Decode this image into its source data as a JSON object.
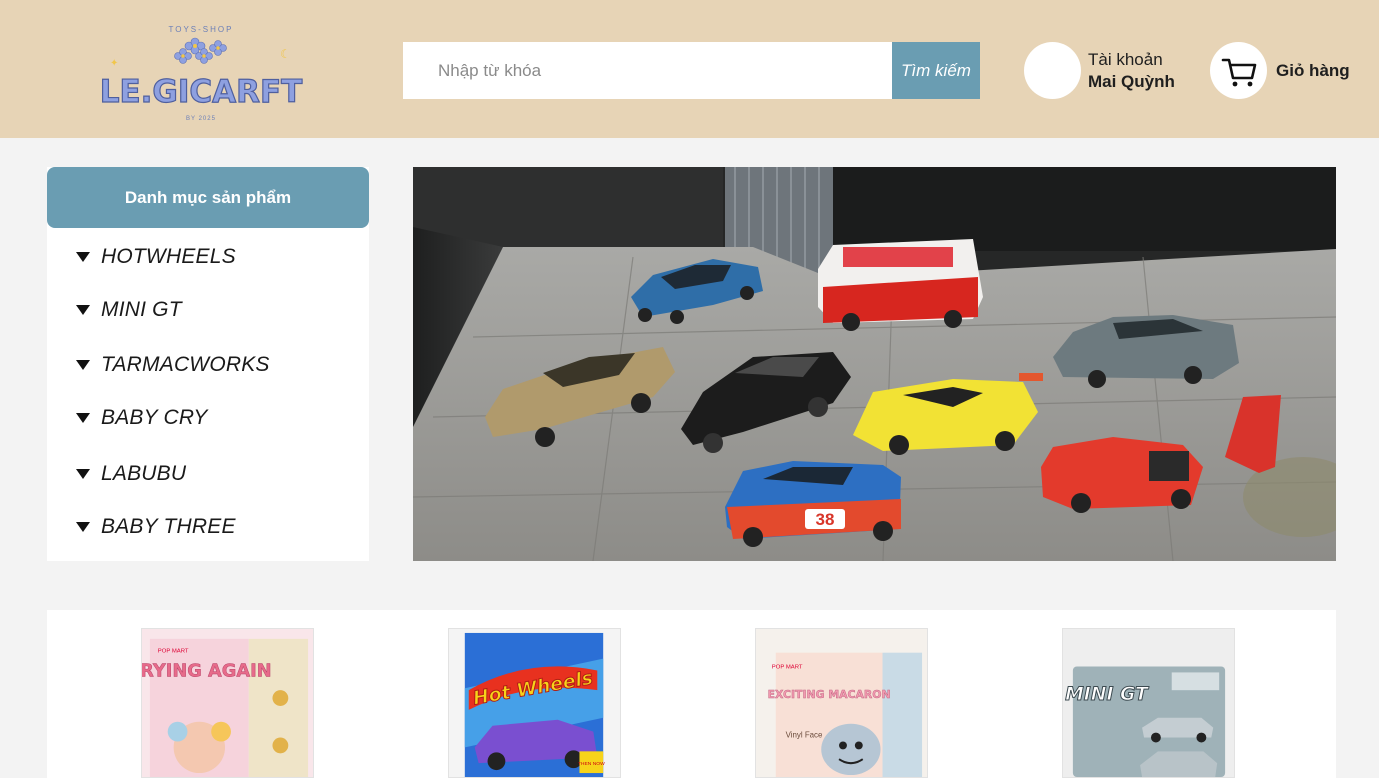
{
  "header": {
    "logo": {
      "top_text": "TOYS-SHOP",
      "brand": "LE.GICARFT",
      "tagline": "BY 2025"
    },
    "search": {
      "placeholder": "Nhập từ khóa",
      "button_label": "Tìm kiếm"
    },
    "account": {
      "label": "Tài khoản",
      "name": "Mai Quỳnh"
    },
    "cart": {
      "label": "Giỏ hàng",
      "icon": "cart-icon"
    }
  },
  "sidebar": {
    "title": "Danh mục sản phẩm",
    "items": [
      {
        "label": "HOTWHEELS"
      },
      {
        "label": "MINI GT"
      },
      {
        "label": "TARMACWORKS"
      },
      {
        "label": "BABY CRY"
      },
      {
        "label": "LABUBU"
      },
      {
        "label": "BABY THREE"
      }
    ]
  },
  "banner": {
    "car_plate": "38"
  },
  "products": [
    {
      "box_text": "CRYING AGAIN",
      "brand": "POP MART"
    },
    {
      "box_text": "Hot Wheels",
      "badge": "THEN NOW"
    },
    {
      "box_text": "EXCITING MACARON",
      "sub": "Vinyl Face",
      "brand": "POP MART"
    },
    {
      "box_text": "MINI GT"
    }
  ],
  "colors": {
    "header_bg": "#e7d4b6",
    "accent": "#6a9db2",
    "page_bg": "#f3f3f3"
  }
}
